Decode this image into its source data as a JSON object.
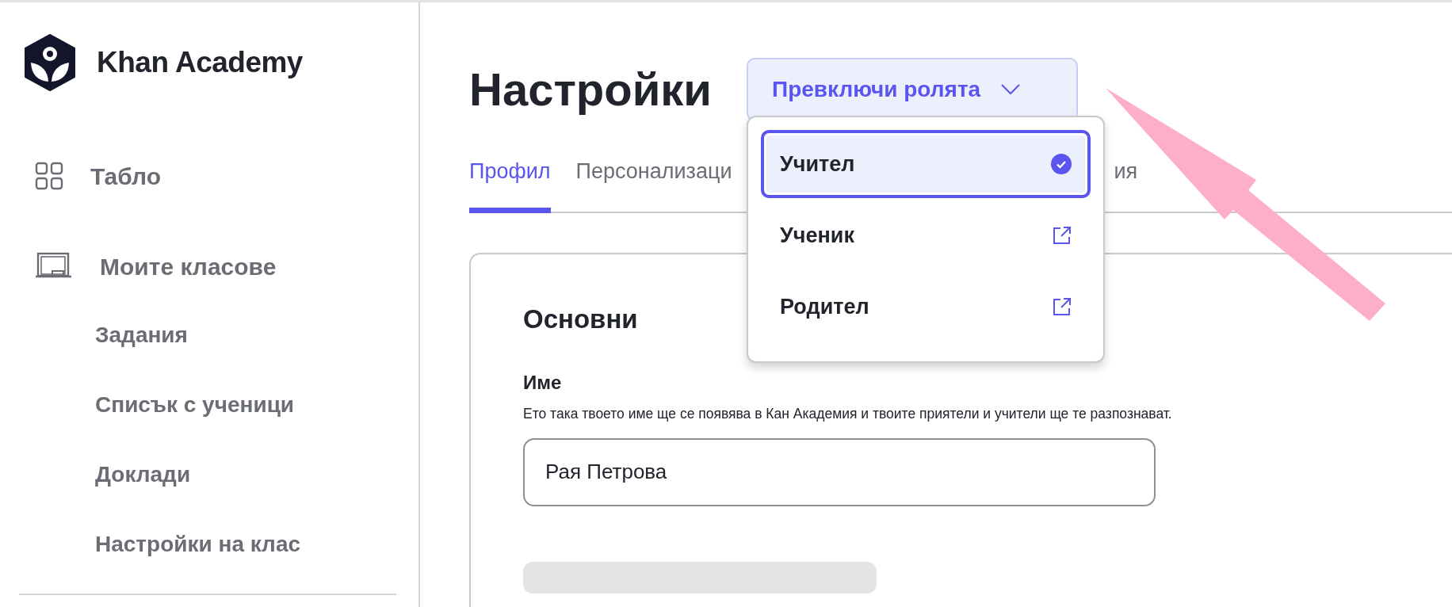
{
  "sidebar": {
    "logo": "Khan Academy",
    "items": [
      {
        "kind": "main",
        "label": "Табло"
      },
      {
        "kind": "main",
        "label": "Моите класове"
      },
      {
        "kind": "sub",
        "label": "Задания"
      },
      {
        "kind": "sub",
        "label": "Списък с ученици"
      },
      {
        "kind": "sub",
        "label": "Доклади"
      },
      {
        "kind": "sub",
        "label": "Настройки на клас"
      }
    ]
  },
  "page": {
    "title": "Настройки"
  },
  "role_switcher": {
    "label": "Превключи ролята",
    "expanded": true,
    "options": [
      {
        "label": "Учител",
        "selected": true
      },
      {
        "label": "Ученик",
        "selected": false
      },
      {
        "label": "Родител",
        "selected": false
      }
    ]
  },
  "tabs": [
    {
      "label": "Профил",
      "selected": true
    },
    {
      "label": "Персонализаци",
      "selected": false
    },
    {
      "label": "ия",
      "selected": false
    }
  ],
  "section": {
    "title": "Основни",
    "fields": [
      {
        "label": "Име",
        "description": "Ето така твоето име ще се появява в Кан Академия и твоите приятели и учители ще те разпознават.",
        "value": "Рая Петрова"
      }
    ]
  }
}
